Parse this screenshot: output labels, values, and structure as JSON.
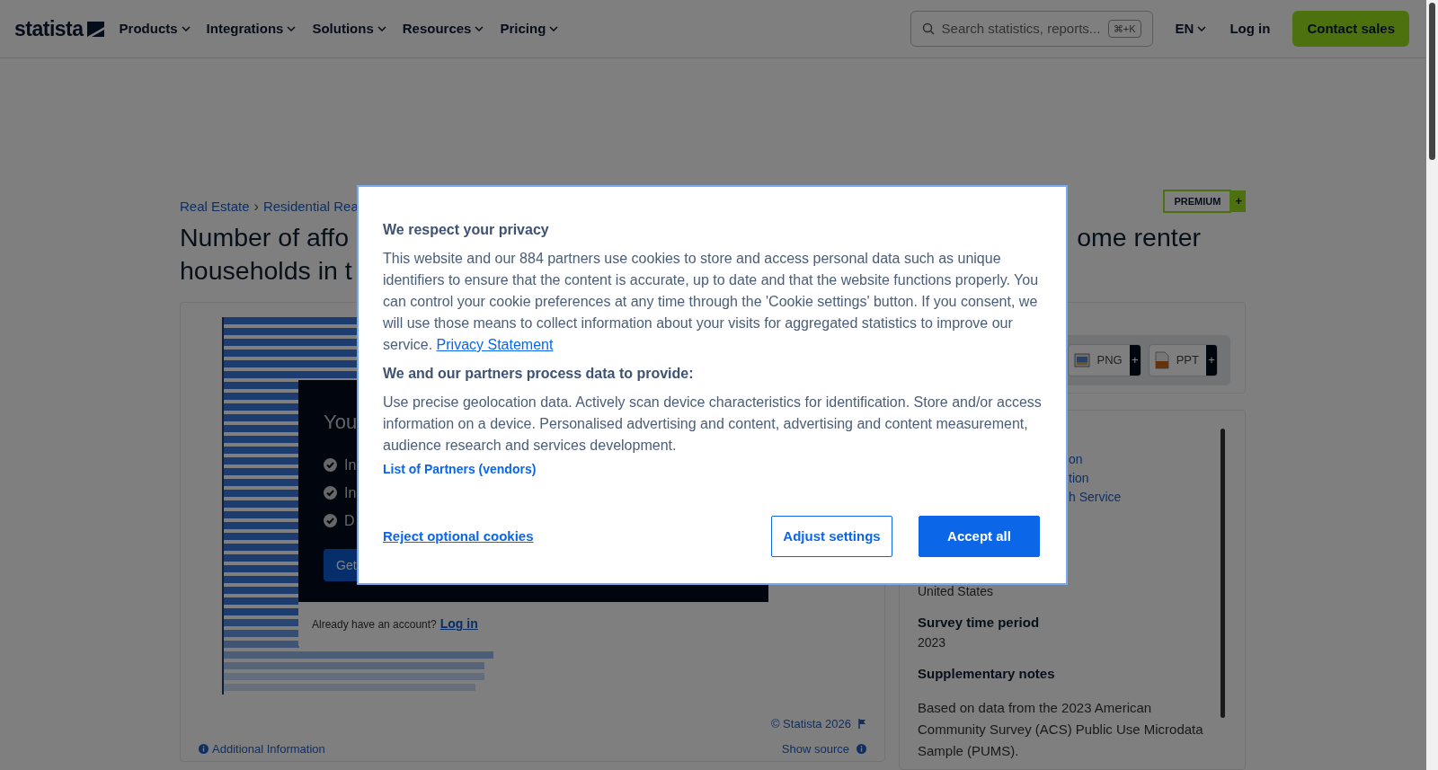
{
  "nav": {
    "logo": "statista",
    "menus": [
      {
        "label": "Products"
      },
      {
        "label": "Integrations"
      },
      {
        "label": "Solutions"
      },
      {
        "label": "Resources"
      },
      {
        "label": "Pricing"
      }
    ],
    "search": {
      "placeholder": "Search statistics, reports...",
      "shortcut": "⌘+K"
    },
    "language": "EN",
    "login": "Log in",
    "cta": "Contact sales"
  },
  "breadcrumb": [
    "Real Estate",
    "Residential Rea"
  ],
  "breadcrumb_separator": "›",
  "badge": {
    "label": "PREMIUM",
    "plus": "+"
  },
  "title": {
    "lines": [
      "Number of affo",
      "households in t"
    ],
    "right_fragment": "ome renter"
  },
  "paywall": {
    "heading": "You",
    "items": [
      "In",
      "In",
      "D"
    ],
    "button": "Get",
    "footer_text": "Already have an account?",
    "footer_link": "Log in"
  },
  "chart_footer": {
    "copyright": "© Statista 2026",
    "info": "Additional Information",
    "source": "Show source"
  },
  "downloads": [
    {
      "label": "PNG",
      "plus": "+",
      "kind": "image"
    },
    {
      "label": "PPT",
      "plus": "+",
      "kind": "slides"
    }
  ],
  "details": {
    "links": [
      "on",
      "tion",
      "h Service"
    ],
    "fields": [
      {
        "value": "United States"
      },
      {
        "label": "Survey time period",
        "value": "2023"
      },
      {
        "label": "Supplementary notes",
        "value": "Based on data from the 2023 American Community Survey (ACS) Public Use Microdata Sample (PUMS)."
      }
    ]
  },
  "dialog": {
    "title": "We respect your privacy",
    "body": "This website and our 884 partners use cookies to store and access personal data such as unique identifiers to ensure that the content is accurate, up to date and that the website functions properly. You can control your cookie preferences at any time through the 'Cookie settings' button. If you consent, we will use those means to collect information about your visits for aggregated statistics to improve our service.",
    "body_link": "Privacy Statement",
    "subtitle": "We and our partners process data to provide:",
    "purposes": "Use precise geolocation data. Actively scan device characteristics for identification. Store and/or access information on a device. Personalised advertising and content, advertising and content measurement, audience research and services development.",
    "vendors_link": "List of Partners (vendors)",
    "reject": "Reject optional cookies",
    "adjust": "Adjust settings",
    "accept": "Accept all"
  }
}
